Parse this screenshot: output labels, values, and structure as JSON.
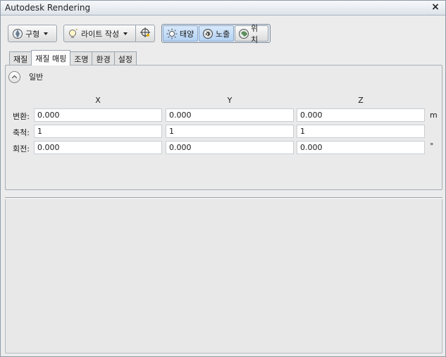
{
  "window": {
    "title": "Autodesk Rendering",
    "close_glyph": "×"
  },
  "toolbar": {
    "preset_label": "구형",
    "light_label": "라이트 작성",
    "sun_label": "태양",
    "exposure_label": "노출",
    "location_label": "위치"
  },
  "tabs": [
    "재질",
    "재질 매핑",
    "조명",
    "환경",
    "설정"
  ],
  "active_tab": "재질 매핑",
  "section": {
    "title": "일반",
    "expanded": true
  },
  "columns": [
    "X",
    "Y",
    "Z"
  ],
  "rows": [
    {
      "label": "변환:",
      "values": [
        "0.000",
        "0.000",
        "0.000"
      ],
      "unit": "m"
    },
    {
      "label": "축척:",
      "values": [
        "1",
        "1",
        "1"
      ],
      "unit": ""
    },
    {
      "label": "회전:",
      "values": [
        "0.000",
        "0.000",
        "0.000"
      ],
      "unit": "°"
    }
  ],
  "colors": {
    "accent": "#b3d2f3",
    "panel": "#eaeaea",
    "border": "#9aa4ae"
  },
  "icons": [
    "globe-icon",
    "light-bulb-icon",
    "crosshair-icon",
    "sun-icon",
    "exposure-icon",
    "location-icon",
    "close-icon",
    "collapse-up-icon"
  ]
}
